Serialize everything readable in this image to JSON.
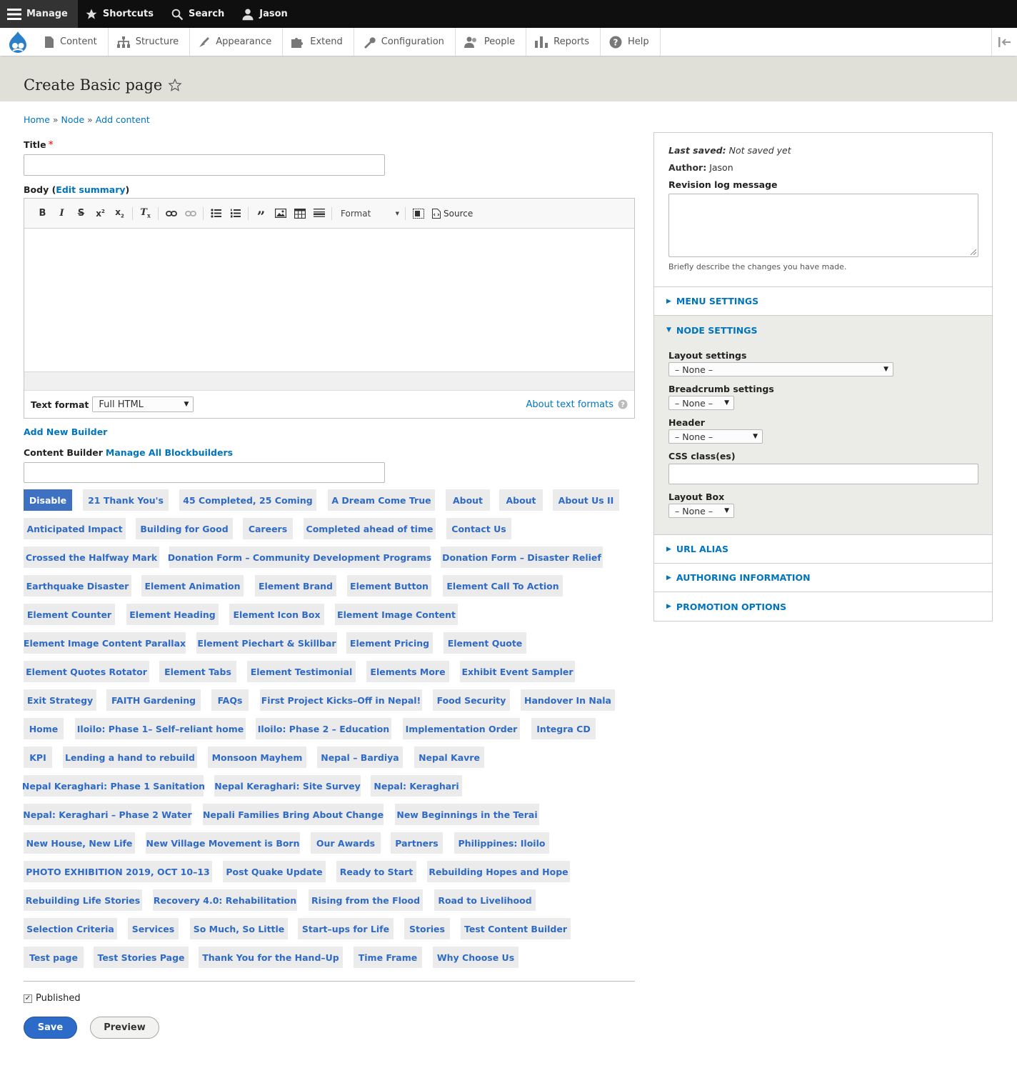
{
  "toolbar": {
    "manage": "Manage",
    "shortcuts": "Shortcuts",
    "search": "Search",
    "user": "Jason"
  },
  "tray": {
    "items": [
      "Content",
      "Structure",
      "Appearance",
      "Extend",
      "Configuration",
      "People",
      "Reports",
      "Help"
    ]
  },
  "page": {
    "title": "Create Basic page"
  },
  "breadcrumb": {
    "home": "Home",
    "sep": "»",
    "node": "Node",
    "add": "Add content"
  },
  "form": {
    "title_label": "Title",
    "required_mark": "*",
    "body_label": "Body",
    "edit_summary": "Edit summary",
    "paren_open": "(",
    "paren_close": ")",
    "format_dropdown": "Format",
    "source_label": "Source",
    "text_format_label": "Text format",
    "text_format_value": "Full HTML",
    "about_text_formats": "About text formats",
    "add_new_builder": "Add New Builder",
    "content_builder_label": "Content Builder",
    "manage_all": "Manage All Blockbuilders",
    "published_label": "Published",
    "save": "Save",
    "preview": "Preview"
  },
  "tags": [
    "Disable",
    "21 Thank You's",
    "45 Completed, 25 Coming",
    "A Dream Come True",
    "About",
    "About",
    "About Us II",
    "Anticipated Impact",
    "Building for Good",
    "Careers",
    "Completed ahead of time",
    "Contact Us",
    "Crossed the Halfway Mark",
    "Donation Form – Community Development Programs",
    "Donation Form – Disaster Relief",
    "Earthquake Disaster",
    "Element Animation",
    "Element Brand",
    "Element Button",
    "Element Call To Action",
    "Element Counter",
    "Element Heading",
    "Element Icon Box",
    "Element Image Content",
    "Element Image Content Parallax",
    "Element Piechart & Skillbar",
    "Element Pricing",
    "Element Quote",
    "Element Quotes Rotator",
    "Element Tabs",
    "Element Testimonial",
    "Elements More",
    "Exhibit Event Sampler",
    "Exit Strategy",
    "FAITH Gardening",
    "FAQs",
    "First Project Kicks–Off in Nepal!",
    "Food Security",
    "Handover In Nala",
    "Home",
    "Iloilo: Phase 1– Self–reliant home",
    "Iloilo: Phase 2 – Education",
    "Implementation Order",
    "Integra CD",
    "KPI",
    "Lending a hand to rebuild",
    "Monsoon Mayhem",
    "Nepal – Bardiya",
    "Nepal Kavre",
    "Nepal Keraghari: Phase 1 Sanitation",
    "Nepal Keraghari: Site Survey",
    "Nepal: Keraghari",
    "Nepal: Keraghari – Phase 2 Water",
    "Nepali Families Bring About Change",
    "New Beginnings in the Terai",
    "New House, New Life",
    "New Village Movement is Born",
    "Our Awards",
    "Partners",
    "Philippines: Iloilo",
    "PHOTO EXHIBITION 2019, OCT 10–13",
    "Post Quake Update",
    "Ready to Start",
    "Rebuilding Hopes and Hope",
    "Rebuilding Life Stories",
    "Recovery 4.0: Rehabilitation",
    "Rising from the Flood",
    "Road to Livelihood",
    "Selection Criteria",
    "Services",
    "So Much, So Little",
    "Start–ups for Life",
    "Stories",
    "Test Content Builder",
    "Test page",
    "Test Stories Page",
    "Thank You for the Hand–Up",
    "Time Frame",
    "Why Choose Us"
  ],
  "sidebar": {
    "last_saved_label": "Last saved:",
    "last_saved_value": "Not saved yet",
    "author_label": "Author:",
    "author_value": "Jason",
    "revision_label": "Revision log message",
    "revision_help": "Briefly describe the changes you have made.",
    "menu_settings": "Menu settings",
    "node_settings": "Node settings",
    "layout_settings_label": "Layout settings",
    "layout_settings_value": "– None –",
    "breadcrumb_settings_label": "Breadcrumb settings",
    "breadcrumb_settings_value": "– None –",
    "header_label": "Header",
    "header_value": "– None –",
    "css_classes_label": "CSS class(es)",
    "layout_box_label": "Layout Box",
    "layout_box_value": "– None –",
    "url_alias": "URL alias",
    "authoring_information": "Authoring information",
    "promotion_options": "Promotion options"
  }
}
